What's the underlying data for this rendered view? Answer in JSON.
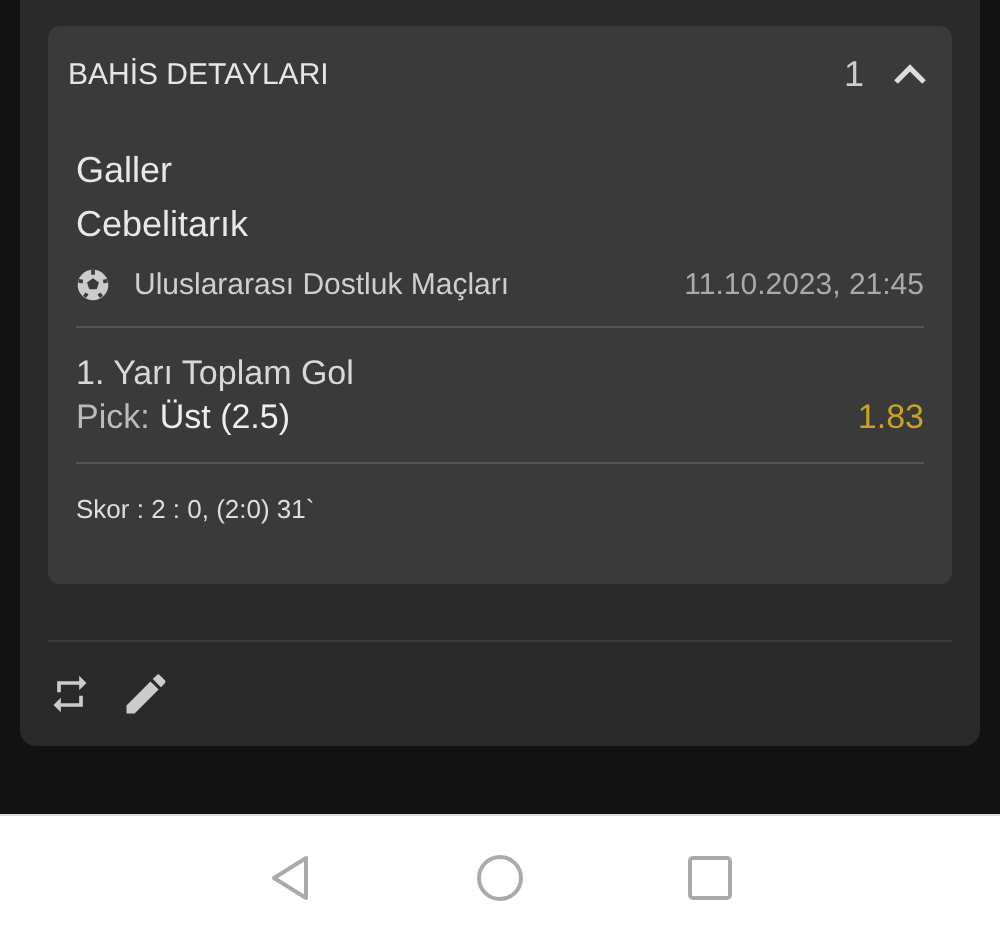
{
  "bet_details": {
    "title": "BAHİS DETAYLARI",
    "count": "1",
    "expanded": true,
    "teams": [
      "Galler",
      "Cebelitarık"
    ],
    "league": "Uluslararası Dostluk Maçları",
    "datetime": "11.10.2023, 21:45",
    "market": "1. Yarı Toplam Gol",
    "pick_label": "Pick:",
    "pick_value": "Üst (2.5)",
    "odds": "1.83",
    "score": "Skor : 2 : 0, (2:0) 31`"
  },
  "actions": [
    {
      "kind": "repeat"
    },
    {
      "kind": "edit"
    }
  ],
  "nav_bar": [
    {
      "kind": "back"
    },
    {
      "kind": "home"
    },
    {
      "kind": "recents"
    }
  ]
}
